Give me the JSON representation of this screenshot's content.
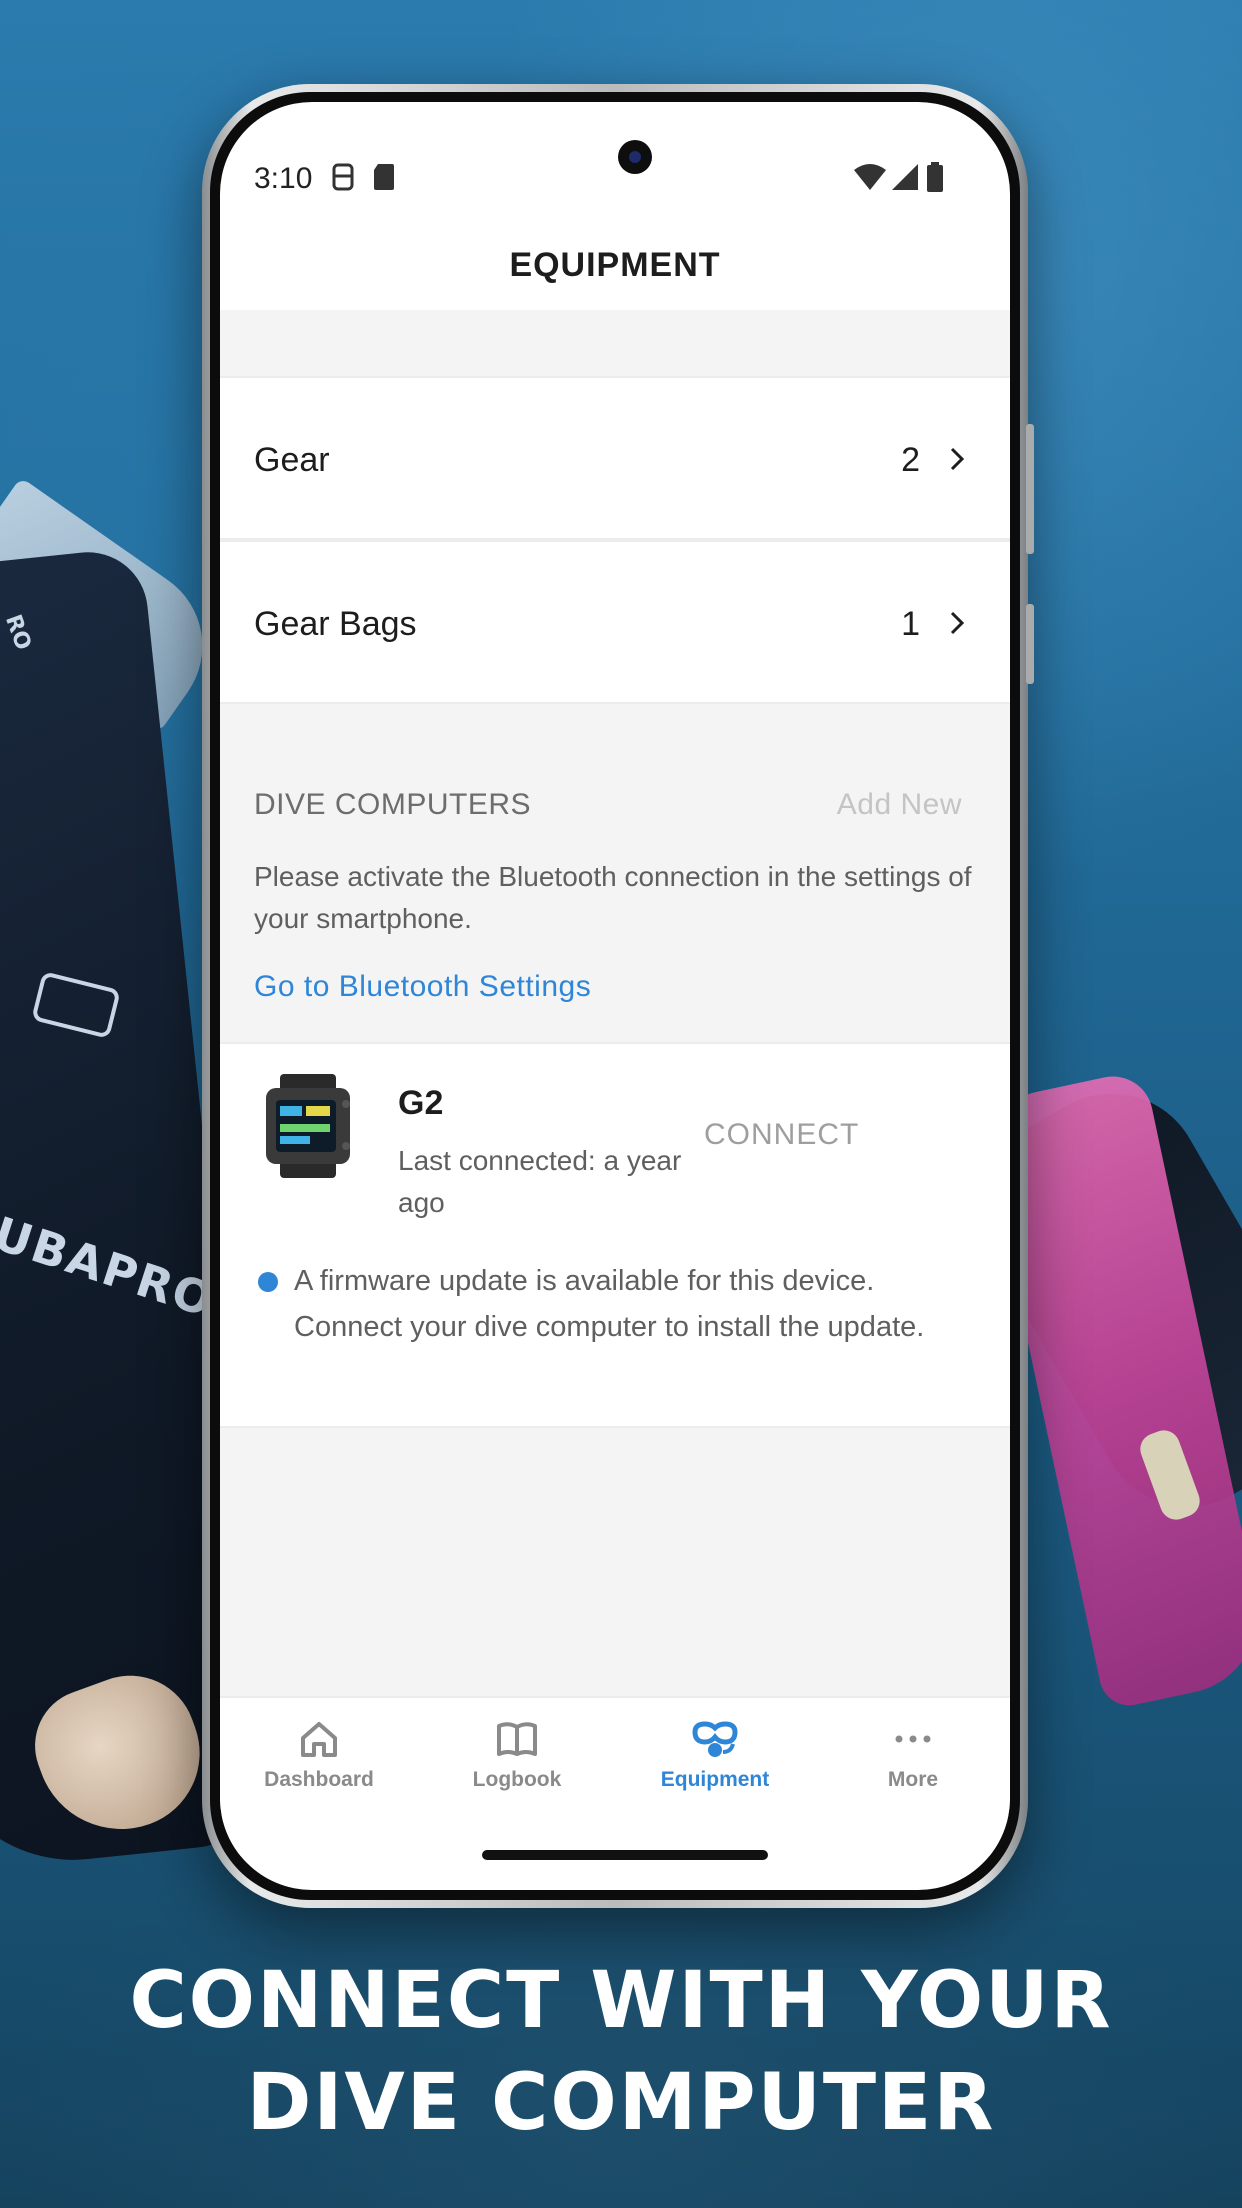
{
  "status_bar": {
    "time": "3:10"
  },
  "header": {
    "title": "EQUIPMENT"
  },
  "list": [
    {
      "label": "Gear",
      "count": "2"
    },
    {
      "label": "Gear Bags",
      "count": "1"
    }
  ],
  "dive_computers": {
    "section_title": "DIVE COMPUTERS",
    "add_new": "Add New",
    "bluetooth_message": "Please activate the Bluetooth connection in the settings of your smartphone.",
    "bluetooth_link": "Go to Bluetooth Settings",
    "device": {
      "name": "G2",
      "last_connected": "Last connected: a year ago",
      "connect_label": "CONNECT",
      "firmware_message": "A firmware update is available for this device. Connect your dive computer to install the update."
    }
  },
  "tabs": [
    {
      "label": "Dashboard",
      "icon": "home-icon",
      "active": false
    },
    {
      "label": "Logbook",
      "icon": "book-icon",
      "active": false
    },
    {
      "label": "Equipment",
      "icon": "dive-mask-icon",
      "active": true
    },
    {
      "label": "More",
      "icon": "more-dots-icon",
      "active": false
    }
  ],
  "tagline": {
    "line1": "CONNECT WITH YOUR",
    "line2": "DIVE COMPUTER"
  },
  "background": {
    "wetsuit_brand_text": "UBAPRO",
    "wetsuit_text_partial": "RO"
  },
  "colors": {
    "accent": "#2f86d6",
    "inactive_tab": "#8a8a8a",
    "list_bg": "#f4f4f4"
  }
}
